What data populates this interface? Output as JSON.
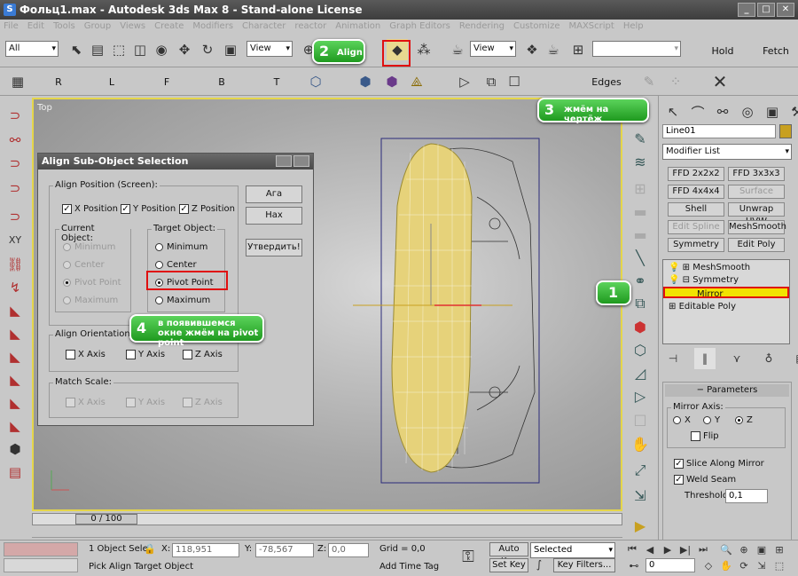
{
  "window": {
    "title": "Фольц1.max - Autodesk 3ds Max 8 - Stand-alone License",
    "controls": [
      "_",
      "□",
      "✕"
    ]
  },
  "menu": [
    "File",
    "Edit",
    "Tools",
    "Group",
    "Views",
    "Create",
    "Modifiers",
    "Character",
    "reactor",
    "Animation",
    "Graph Editors",
    "Rendering",
    "Customize",
    "MAXScript",
    "Help"
  ],
  "toolbar": {
    "selection_filter": "All",
    "ref_coord": "View",
    "ref_coord2": "View",
    "hold": "Hold",
    "fetch": "Fetch"
  },
  "axis_toolbar": {
    "labels": [
      "R",
      "L",
      "F",
      "B",
      "T"
    ],
    "edges": "Edges"
  },
  "viewport": {
    "label": "Top"
  },
  "dialog": {
    "title": "Align Sub-Object Selection",
    "align_position_label": "Align Position (Screen):",
    "x_position": "X Position",
    "y_position": "Y Position",
    "z_position": "Z Position",
    "current_object_label": "Current Object:",
    "target_object_label": "Target Object:",
    "current_options": [
      "Minimum",
      "Center",
      "Pivot Point",
      "Maximum"
    ],
    "target_options": [
      "Minimum",
      "Center",
      "Pivot Point",
      "Maximum"
    ],
    "align_orientation_label": "Align Orientation (Lo",
    "x_axis": "X Axis",
    "y_axis": "Y Axis",
    "z_axis": "Z Axis",
    "match_scale_label": "Match Scale:",
    "apply_button": "Ага",
    "cancel_button": "Нах",
    "ok_button": "Утвердить!"
  },
  "callouts": {
    "c1": "1",
    "c2_num": "2",
    "c2_text": "Align",
    "c3_num": "3",
    "c3_text": "жмём на чертёж",
    "c4_num": "4",
    "c4_text": "в появившемся окне жмём на pivot point"
  },
  "command_panel": {
    "object_name": "Line01",
    "modifier_list": "Modifier List",
    "buttons": [
      {
        "label": "FFD 2x2x2",
        "disabled": false
      },
      {
        "label": "FFD 3x3x3",
        "disabled": false
      },
      {
        "label": "FFD 4x4x4",
        "disabled": false
      },
      {
        "label": "Surface",
        "disabled": true
      },
      {
        "label": "Shell",
        "disabled": false
      },
      {
        "label": "Unwrap UVW",
        "disabled": false
      },
      {
        "label": "Edit Spline",
        "disabled": true
      },
      {
        "label": "MeshSmooth",
        "disabled": false
      },
      {
        "label": "Symmetry",
        "disabled": false
      },
      {
        "label": "Edit Poly",
        "disabled": false
      }
    ],
    "stack": [
      "MeshSmooth",
      "Symmetry",
      "Mirror",
      "Editable Poly"
    ],
    "parameters_title": "Parameters",
    "mirror_axis_label": "Mirror Axis:",
    "axes": [
      "X",
      "Y",
      "Z"
    ],
    "flip": "Flip",
    "slice_along_mirror": "Slice Along Mirror",
    "weld_seam": "Weld Seam",
    "threshold_label": "Threshold:",
    "threshold_value": "0,1"
  },
  "timeline": {
    "frame": "0 / 100"
  },
  "status": {
    "selection": "1 Object Sele",
    "x_label": "X:",
    "x_value": "118,951",
    "y_label": "Y:",
    "y_value": "-78,567",
    "z_label": "Z:",
    "z_value": "0,0",
    "grid": "Grid = 0,0",
    "auto_key": "Auto Key",
    "selected": "Selected",
    "set_key": "Set Key",
    "key_filters": "Key Filters...",
    "prompt": "Pick Align Target Object",
    "add_time_tag": "Add Time Tag",
    "frame_field": "0"
  }
}
